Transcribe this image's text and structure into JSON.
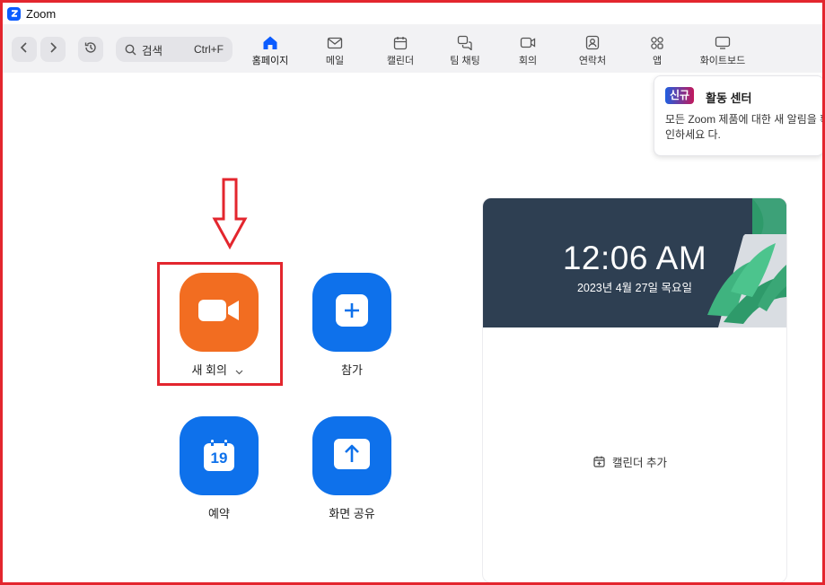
{
  "window": {
    "title": "Zoom"
  },
  "toolbar": {
    "search_label": "검색",
    "search_shortcut": "Ctrl+F",
    "tabs": [
      {
        "label": "홈페이지",
        "icon": "home-icon"
      },
      {
        "label": "메일",
        "icon": "mail-icon"
      },
      {
        "label": "캘린더",
        "icon": "calendar-icon"
      },
      {
        "label": "팀 채팅",
        "icon": "chat-icon"
      },
      {
        "label": "회의",
        "icon": "video-icon"
      },
      {
        "label": "연락처",
        "icon": "contacts-icon"
      },
      {
        "label": "앱",
        "icon": "apps-icon"
      },
      {
        "label": "화이트보드",
        "icon": "whiteboard-icon"
      }
    ]
  },
  "notice": {
    "badge": "신규",
    "title": "활동 센터",
    "body": "모든 Zoom 제품에 대한 새 알림을 확인하세요 다."
  },
  "actions": {
    "new_meeting": "새 회의",
    "join": "참가",
    "schedule": "예약",
    "schedule_day": "19",
    "share_screen": "화면 공유"
  },
  "clock": {
    "time": "12:06 AM",
    "date": "2023년 4월 27일 목요일",
    "add_calendar": "캘린더 추가"
  },
  "colors": {
    "accent_blue": "#0e71eb",
    "accent_orange": "#f26d21",
    "annotation_red": "#e3262e",
    "banner": "#2e3f52"
  }
}
